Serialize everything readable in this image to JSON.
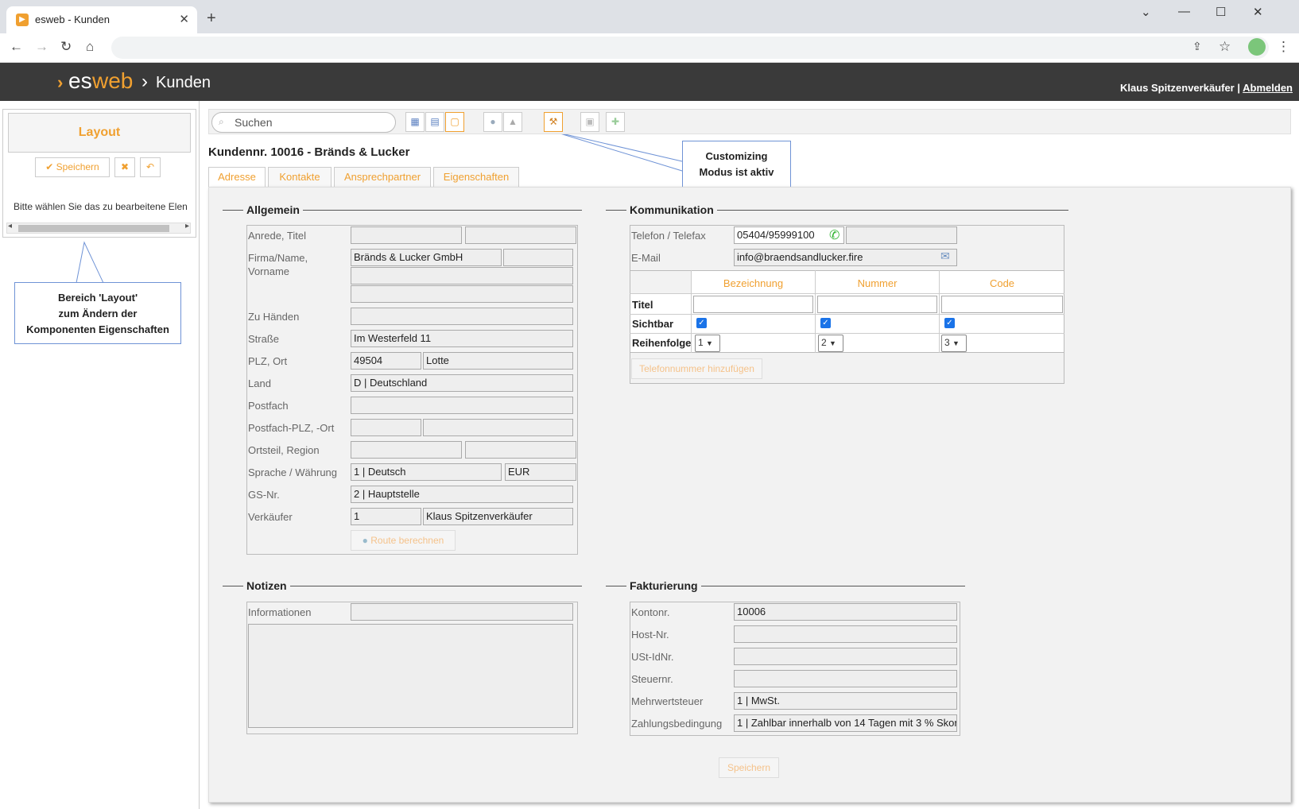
{
  "browser": {
    "tab_title": "esweb - Kunden",
    "tab_close": "✕",
    "new_tab": "+",
    "favicon": "play-icon",
    "window_controls": [
      "⌄",
      "—",
      "☐",
      "✕"
    ]
  },
  "nav": {
    "back": "←",
    "forward": "→",
    "reload": "↻",
    "home": "⌂",
    "share": "⇪",
    "star": "☆",
    "menu": "⋮"
  },
  "header": {
    "logo_arrow": "›",
    "logo_es": "es",
    "logo_web": "web",
    "separator": "›",
    "page": "Kunden",
    "user": "Klaus Spitzenverkäufer",
    "user_sep": "|",
    "logout": "Abmelden"
  },
  "left_panel": {
    "title": "Layout",
    "save_label": "✔ Speichern",
    "cancel_icon": "✖",
    "undo_icon": "↶",
    "hint": "Bitte wählen Sie das zu bearbeitene Elen",
    "scroll_left": "◂",
    "scroll_right": "▸"
  },
  "callouts": {
    "layout_area": [
      "Bereich 'Layout'",
      "zum Ändern der",
      "Komponenten Eigenschaften"
    ],
    "customizing": [
      "Customizing",
      "Modus ist aktiv"
    ]
  },
  "toolbar": {
    "search_placeholder": "Suchen",
    "search_icon": "⌕",
    "buttons": [
      "▦",
      "▤",
      "▢",
      "●",
      "▲",
      "⚒",
      "▣",
      "✚"
    ]
  },
  "record": {
    "title": "Kundennr. 10016 - Bränds & Lucker",
    "tabs": [
      "Adresse",
      "Kontakte",
      "Ansprechpartner",
      "Eigenschaften"
    ]
  },
  "allgemein": {
    "title": "Allgemein",
    "labels": {
      "anrede": "Anrede, Titel",
      "firma": "Firma/Name,",
      "vorname": "Vorname",
      "zuhaenden": "Zu Händen",
      "strasse": "Straße",
      "plzort": "PLZ, Ort",
      "land": "Land",
      "postfach": "Postfach",
      "postfachplz": "Postfach-PLZ, -Ort",
      "ortsteil": "Ortsteil, Region",
      "sprache": "Sprache / Währung",
      "gsnr": "GS-Nr.",
      "verkaeufer": "Verkäufer"
    },
    "values": {
      "firma": "Bränds & Lucker GmbH",
      "strasse": "Im Westerfeld 11",
      "plz": "49504",
      "ort": "Lotte",
      "land": "D   | Deutschland",
      "sprache": "1 | Deutsch",
      "waehrung": "EUR",
      "gsnr": "2  | Hauptstelle",
      "verkaeufer_nr": "1",
      "verkaeufer_name": "Klaus Spitzenverkäufer"
    },
    "route_button": "Route berechnen"
  },
  "kommunikation": {
    "title": "Kommunikation",
    "labels": {
      "telefon": "Telefon / Telefax",
      "email": "E-Mail"
    },
    "values": {
      "telefon": "05404/95999100",
      "email": "info@braendsandlucker.fire"
    },
    "phone_icon": "✆",
    "mail_icon": "✉",
    "grid_headers": [
      "Bezeichnung",
      "Nummer",
      "Code"
    ],
    "rows": {
      "titel": "Titel",
      "sichtbar": "Sichtbar",
      "reihenfolge": "Reihenfolge"
    },
    "order_values": [
      "1",
      "2",
      "3"
    ],
    "check": "✓",
    "add_phone": "Telefonnummer hinzufügen"
  },
  "notizen": {
    "title": "Notizen",
    "informationen": "Informationen"
  },
  "fakturierung": {
    "title": "Fakturierung",
    "labels": {
      "kontonr": "Kontonr.",
      "hostnr": "Host-Nr.",
      "ustid": "USt-IdNr.",
      "steuernr": "Steuernr.",
      "mwst": "Mehrwertsteuer",
      "zahlung": "Zahlungsbedingung"
    },
    "values": {
      "kontonr": "10006",
      "mwst": "1 | MwSt.",
      "zahlung": "1 | Zahlbar innerhalb von 14 Tagen mit 3 % Skor"
    }
  },
  "save_button": "Speichern"
}
